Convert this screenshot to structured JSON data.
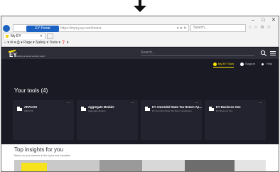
{
  "browser": {
    "tab_title": "My EY",
    "url_pill": "EY Portal",
    "url_text": "https://myey.ey.com/home",
    "url_tools": "▾ ✕ ↻",
    "search_placeholder": "Search...",
    "window_controls": [
      "–",
      "□",
      "✕"
    ],
    "right_icons": "⌂ ☆ ⚙ ☺",
    "command_bar": "⌂ ▾ ✉ ▾ ⎙ ▾  Page ▾  Safety ▾  Tools ▾  ❓ ▾"
  },
  "header": {
    "logo_text": "EY",
    "logo_tagline": "Building a better working world",
    "search_placeholder": "Search..."
  },
  "subnav": {
    "items": [
      {
        "label": "My EY Tools",
        "active": true
      },
      {
        "label": "Support",
        "active": false
      },
      {
        "label": "Help",
        "active": false
      }
    ]
  },
  "tools": {
    "title": "Your tools (4)",
    "more_label": "···",
    "cards": [
      {
        "name": "ARACOS",
        "desc": "ARACOS"
      },
      {
        "name": "Aggregate Module",
        "desc": "Aggregate Module"
      },
      {
        "name": "EY Amended State Tax Return Ap...",
        "desc": "EY Amended State Tax Return Application"
      },
      {
        "name": "EY Business One",
        "desc": "EY Business One"
      }
    ]
  },
  "insights": {
    "title": "Top insights for you",
    "subtitle": "Based on your interests in the topics and industries"
  },
  "colors": {
    "brand_yellow": "#ffe600",
    "app_bg": "#1a1a24",
    "header_bg": "#2e2e38",
    "card_bg": "#23232f",
    "browser_blue": "#1c62c2"
  }
}
